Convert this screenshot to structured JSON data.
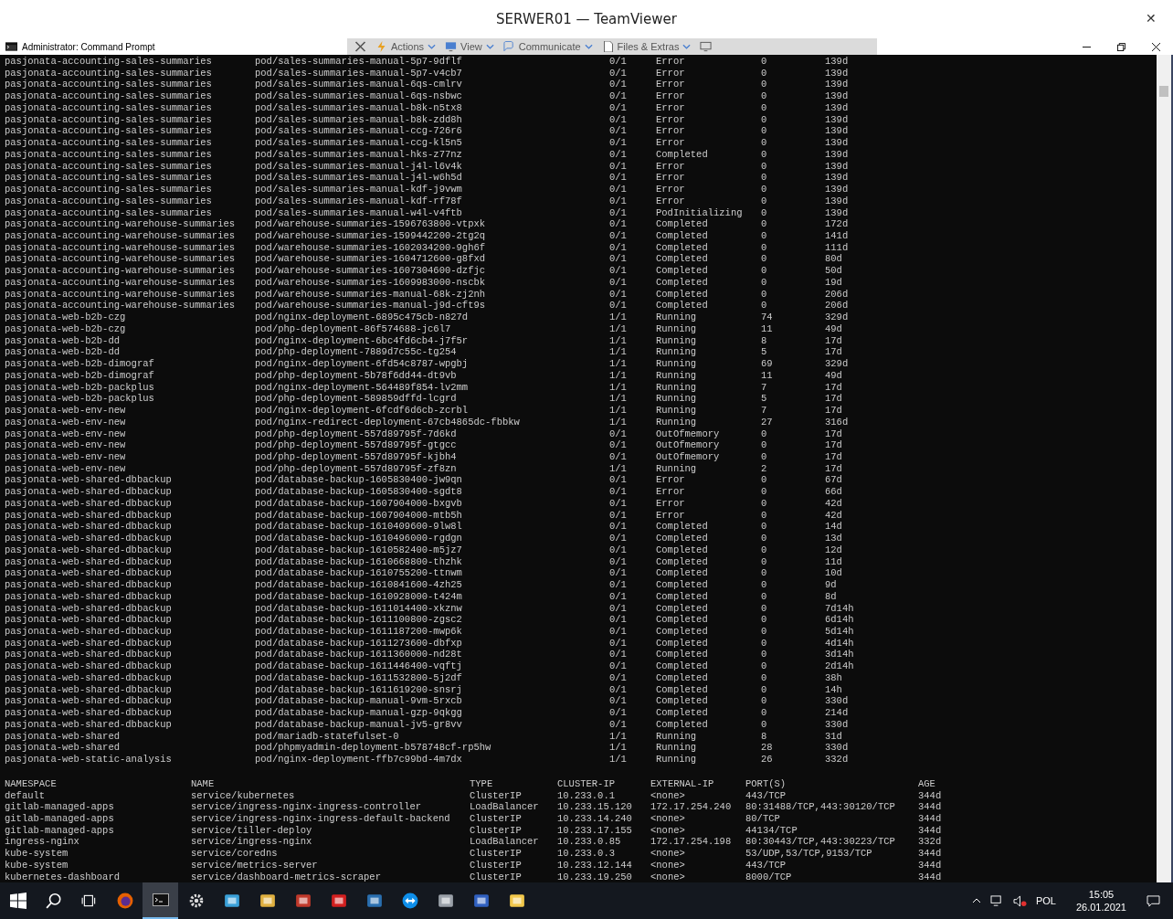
{
  "window": {
    "title": "SERWER01 — TeamViewer",
    "close": "✕"
  },
  "console": {
    "title": "Administrator: Command Prompt",
    "controls": [
      {
        "kind": "minimize"
      },
      {
        "kind": "maximize"
      },
      {
        "kind": "close"
      }
    ]
  },
  "toolbar": {
    "items": [
      {
        "kind": "close"
      },
      {
        "kind": "actions",
        "label": "Actions"
      },
      {
        "kind": "view",
        "label": "View"
      },
      {
        "kind": "communicate",
        "label": "Communicate"
      },
      {
        "kind": "files",
        "label": "Files & Extras"
      },
      {
        "kind": "monitor"
      }
    ]
  },
  "pods": {
    "rows": [
      [
        "pasjonata-accounting-sales-summaries",
        "pod/sales-summaries-manual-5p7-9dflf",
        "0/1",
        "Error",
        "0",
        "139d"
      ],
      [
        "pasjonata-accounting-sales-summaries",
        "pod/sales-summaries-manual-5p7-v4cb7",
        "0/1",
        "Error",
        "0",
        "139d"
      ],
      [
        "pasjonata-accounting-sales-summaries",
        "pod/sales-summaries-manual-6qs-cmlrv",
        "0/1",
        "Error",
        "0",
        "139d"
      ],
      [
        "pasjonata-accounting-sales-summaries",
        "pod/sales-summaries-manual-6qs-nsbwc",
        "0/1",
        "Error",
        "0",
        "139d"
      ],
      [
        "pasjonata-accounting-sales-summaries",
        "pod/sales-summaries-manual-b8k-n5tx8",
        "0/1",
        "Error",
        "0",
        "139d"
      ],
      [
        "pasjonata-accounting-sales-summaries",
        "pod/sales-summaries-manual-b8k-zdd8h",
        "0/1",
        "Error",
        "0",
        "139d"
      ],
      [
        "pasjonata-accounting-sales-summaries",
        "pod/sales-summaries-manual-ccg-726r6",
        "0/1",
        "Error",
        "0",
        "139d"
      ],
      [
        "pasjonata-accounting-sales-summaries",
        "pod/sales-summaries-manual-ccg-kl5n5",
        "0/1",
        "Error",
        "0",
        "139d"
      ],
      [
        "pasjonata-accounting-sales-summaries",
        "pod/sales-summaries-manual-hks-z77nz",
        "0/1",
        "Completed",
        "0",
        "139d"
      ],
      [
        "pasjonata-accounting-sales-summaries",
        "pod/sales-summaries-manual-j4l-l6v4k",
        "0/1",
        "Error",
        "0",
        "139d"
      ],
      [
        "pasjonata-accounting-sales-summaries",
        "pod/sales-summaries-manual-j4l-w6h5d",
        "0/1",
        "Error",
        "0",
        "139d"
      ],
      [
        "pasjonata-accounting-sales-summaries",
        "pod/sales-summaries-manual-kdf-j9vwm",
        "0/1",
        "Error",
        "0",
        "139d"
      ],
      [
        "pasjonata-accounting-sales-summaries",
        "pod/sales-summaries-manual-kdf-rf78f",
        "0/1",
        "Error",
        "0",
        "139d"
      ],
      [
        "pasjonata-accounting-sales-summaries",
        "pod/sales-summaries-manual-w4l-v4ftb",
        "0/1",
        "PodInitializing",
        "0",
        "139d"
      ],
      [
        "pasjonata-accounting-warehouse-summaries",
        "pod/warehouse-summaries-1596763800-vtpxk",
        "0/1",
        "Completed",
        "0",
        "172d"
      ],
      [
        "pasjonata-accounting-warehouse-summaries",
        "pod/warehouse-summaries-1599442200-2tg2q",
        "0/1",
        "Completed",
        "0",
        "141d"
      ],
      [
        "pasjonata-accounting-warehouse-summaries",
        "pod/warehouse-summaries-1602034200-9gh6f",
        "0/1",
        "Completed",
        "0",
        "111d"
      ],
      [
        "pasjonata-accounting-warehouse-summaries",
        "pod/warehouse-summaries-1604712600-g8fxd",
        "0/1",
        "Completed",
        "0",
        "80d"
      ],
      [
        "pasjonata-accounting-warehouse-summaries",
        "pod/warehouse-summaries-1607304600-dzfjc",
        "0/1",
        "Completed",
        "0",
        "50d"
      ],
      [
        "pasjonata-accounting-warehouse-summaries",
        "pod/warehouse-summaries-1609983000-nscbk",
        "0/1",
        "Completed",
        "0",
        "19d"
      ],
      [
        "pasjonata-accounting-warehouse-summaries",
        "pod/warehouse-summaries-manual-68k-zj2nh",
        "0/1",
        "Completed",
        "0",
        "206d"
      ],
      [
        "pasjonata-accounting-warehouse-summaries",
        "pod/warehouse-summaries-manual-j9d-cft9s",
        "0/1",
        "Completed",
        "0",
        "206d"
      ],
      [
        "pasjonata-web-b2b-czg",
        "pod/nginx-deployment-6895c475cb-n827d",
        "1/1",
        "Running",
        "74",
        "329d"
      ],
      [
        "pasjonata-web-b2b-czg",
        "pod/php-deployment-86f574688-jc6l7",
        "1/1",
        "Running",
        "11",
        "49d"
      ],
      [
        "pasjonata-web-b2b-dd",
        "pod/nginx-deployment-6bc4fd6cb4-j7f5r",
        "1/1",
        "Running",
        "8",
        "17d"
      ],
      [
        "pasjonata-web-b2b-dd",
        "pod/php-deployment-7889d7c55c-tg254",
        "1/1",
        "Running",
        "5",
        "17d"
      ],
      [
        "pasjonata-web-b2b-dimograf",
        "pod/nginx-deployment-6fd54c8787-wpgbj",
        "1/1",
        "Running",
        "69",
        "329d"
      ],
      [
        "pasjonata-web-b2b-dimograf",
        "pod/php-deployment-5b78f6dd44-dt9vb",
        "1/1",
        "Running",
        "11",
        "49d"
      ],
      [
        "pasjonata-web-b2b-packplus",
        "pod/nginx-deployment-564489f854-lv2mm",
        "1/1",
        "Running",
        "7",
        "17d"
      ],
      [
        "pasjonata-web-b2b-packplus",
        "pod/php-deployment-589859dffd-lcgrd",
        "1/1",
        "Running",
        "5",
        "17d"
      ],
      [
        "pasjonata-web-env-new",
        "pod/nginx-deployment-6fcdf6d6cb-zcrbl",
        "1/1",
        "Running",
        "7",
        "17d"
      ],
      [
        "pasjonata-web-env-new",
        "pod/nginx-redirect-deployment-67cb4865dc-fbbkw",
        "1/1",
        "Running",
        "27",
        "316d"
      ],
      [
        "pasjonata-web-env-new",
        "pod/php-deployment-557d89795f-7d6kd",
        "0/1",
        "OutOfmemory",
        "0",
        "17d"
      ],
      [
        "pasjonata-web-env-new",
        "pod/php-deployment-557d89795f-gtgcc",
        "0/1",
        "OutOfmemory",
        "0",
        "17d"
      ],
      [
        "pasjonata-web-env-new",
        "pod/php-deployment-557d89795f-kjbh4",
        "0/1",
        "OutOfmemory",
        "0",
        "17d"
      ],
      [
        "pasjonata-web-env-new",
        "pod/php-deployment-557d89795f-zf8zn",
        "1/1",
        "Running",
        "2",
        "17d"
      ],
      [
        "pasjonata-web-shared-dbbackup",
        "pod/database-backup-1605830400-jw9qn",
        "0/1",
        "Error",
        "0",
        "67d"
      ],
      [
        "pasjonata-web-shared-dbbackup",
        "pod/database-backup-1605830400-sgdt8",
        "0/1",
        "Error",
        "0",
        "66d"
      ],
      [
        "pasjonata-web-shared-dbbackup",
        "pod/database-backup-1607904000-bxgvb",
        "0/1",
        "Error",
        "0",
        "42d"
      ],
      [
        "pasjonata-web-shared-dbbackup",
        "pod/database-backup-1607904000-mtb5h",
        "0/1",
        "Error",
        "0",
        "42d"
      ],
      [
        "pasjonata-web-shared-dbbackup",
        "pod/database-backup-1610409600-9lw8l",
        "0/1",
        "Completed",
        "0",
        "14d"
      ],
      [
        "pasjonata-web-shared-dbbackup",
        "pod/database-backup-1610496000-rgdgn",
        "0/1",
        "Completed",
        "0",
        "13d"
      ],
      [
        "pasjonata-web-shared-dbbackup",
        "pod/database-backup-1610582400-m5jz7",
        "0/1",
        "Completed",
        "0",
        "12d"
      ],
      [
        "pasjonata-web-shared-dbbackup",
        "pod/database-backup-1610668800-thzhk",
        "0/1",
        "Completed",
        "0",
        "11d"
      ],
      [
        "pasjonata-web-shared-dbbackup",
        "pod/database-backup-1610755200-ttnwm",
        "0/1",
        "Completed",
        "0",
        "10d"
      ],
      [
        "pasjonata-web-shared-dbbackup",
        "pod/database-backup-1610841600-4zh25",
        "0/1",
        "Completed",
        "0",
        "9d"
      ],
      [
        "pasjonata-web-shared-dbbackup",
        "pod/database-backup-1610928000-t424m",
        "0/1",
        "Completed",
        "0",
        "8d"
      ],
      [
        "pasjonata-web-shared-dbbackup",
        "pod/database-backup-1611014400-xkznw",
        "0/1",
        "Completed",
        "0",
        "7d14h"
      ],
      [
        "pasjonata-web-shared-dbbackup",
        "pod/database-backup-1611100800-zgsc2",
        "0/1",
        "Completed",
        "0",
        "6d14h"
      ],
      [
        "pasjonata-web-shared-dbbackup",
        "pod/database-backup-1611187200-mwp6k",
        "0/1",
        "Completed",
        "0",
        "5d14h"
      ],
      [
        "pasjonata-web-shared-dbbackup",
        "pod/database-backup-1611273600-dbfxp",
        "0/1",
        "Completed",
        "0",
        "4d14h"
      ],
      [
        "pasjonata-web-shared-dbbackup",
        "pod/database-backup-1611360000-nd28t",
        "0/1",
        "Completed",
        "0",
        "3d14h"
      ],
      [
        "pasjonata-web-shared-dbbackup",
        "pod/database-backup-1611446400-vqftj",
        "0/1",
        "Completed",
        "0",
        "2d14h"
      ],
      [
        "pasjonata-web-shared-dbbackup",
        "pod/database-backup-1611532800-5j2df",
        "0/1",
        "Completed",
        "0",
        "38h"
      ],
      [
        "pasjonata-web-shared-dbbackup",
        "pod/database-backup-1611619200-snsrj",
        "0/1",
        "Completed",
        "0",
        "14h"
      ],
      [
        "pasjonata-web-shared-dbbackup",
        "pod/database-backup-manual-9vm-5rxcb",
        "0/1",
        "Completed",
        "0",
        "330d"
      ],
      [
        "pasjonata-web-shared-dbbackup",
        "pod/database-backup-manual-gzp-9qkgg",
        "0/1",
        "Completed",
        "0",
        "214d"
      ],
      [
        "pasjonata-web-shared-dbbackup",
        "pod/database-backup-manual-jv5-gr8vv",
        "0/1",
        "Completed",
        "0",
        "330d"
      ],
      [
        "pasjonata-web-shared",
        "pod/mariadb-statefulset-0",
        "1/1",
        "Running",
        "8",
        "31d"
      ],
      [
        "pasjonata-web-shared",
        "pod/phpmyadmin-deployment-b578748cf-rp5hw",
        "1/1",
        "Running",
        "28",
        "330d"
      ],
      [
        "pasjonata-web-static-analysis",
        "pod/nginx-deployment-ffb7c99bd-4m7dx",
        "1/1",
        "Running",
        "26",
        "332d"
      ]
    ]
  },
  "services": {
    "columns": [
      "NAMESPACE",
      "NAME",
      "TYPE",
      "CLUSTER-IP",
      "EXTERNAL-IP",
      "PORT(S)",
      "AGE"
    ],
    "rows": [
      [
        "default",
        "service/kubernetes",
        "ClusterIP",
        "10.233.0.1",
        "<none>",
        "443/TCP",
        "344d"
      ],
      [
        "gitlab-managed-apps",
        "service/ingress-nginx-ingress-controller",
        "LoadBalancer",
        "10.233.15.120",
        "172.17.254.240",
        "80:31488/TCP,443:30120/TCP",
        "344d"
      ],
      [
        "gitlab-managed-apps",
        "service/ingress-nginx-ingress-default-backend",
        "ClusterIP",
        "10.233.14.240",
        "<none>",
        "80/TCP",
        "344d"
      ],
      [
        "gitlab-managed-apps",
        "service/tiller-deploy",
        "ClusterIP",
        "10.233.17.155",
        "<none>",
        "44134/TCP",
        "344d"
      ],
      [
        "ingress-nginx",
        "service/ingress-nginx",
        "LoadBalancer",
        "10.233.0.85",
        "172.17.254.198",
        "80:30443/TCP,443:30223/TCP",
        "332d"
      ],
      [
        "kube-system",
        "service/coredns",
        "ClusterIP",
        "10.233.0.3",
        "<none>",
        "53/UDP,53/TCP,9153/TCP",
        "344d"
      ],
      [
        "kube-system",
        "service/metrics-server",
        "ClusterIP",
        "10.233.12.144",
        "<none>",
        "443/TCP",
        "344d"
      ],
      [
        "kubernetes-dashboard",
        "service/dashboard-metrics-scraper",
        "ClusterIP",
        "10.233.19.250",
        "<none>",
        "8000/TCP",
        "344d"
      ]
    ]
  },
  "taskbar": {
    "apps": [
      {
        "kind": "start",
        "selected": false
      },
      {
        "kind": "search",
        "selected": false
      },
      {
        "kind": "taskview",
        "selected": false
      },
      {
        "kind": "browser",
        "selected": false
      },
      {
        "kind": "terminal",
        "selected": true
      },
      {
        "kind": "gear",
        "selected": false
      },
      {
        "kind": "building",
        "selected": false
      },
      {
        "kind": "folder-arrow",
        "selected": false
      },
      {
        "kind": "stack",
        "selected": false
      },
      {
        "kind": "pdf",
        "selected": false
      },
      {
        "kind": "envelope",
        "selected": false
      },
      {
        "kind": "remote",
        "selected": false
      },
      {
        "kind": "server",
        "selected": false
      },
      {
        "kind": "network",
        "selected": false
      },
      {
        "kind": "folder",
        "selected": false
      }
    ],
    "tray": {
      "language": "POL",
      "time": "15:05",
      "date": "26.01.2021"
    }
  }
}
